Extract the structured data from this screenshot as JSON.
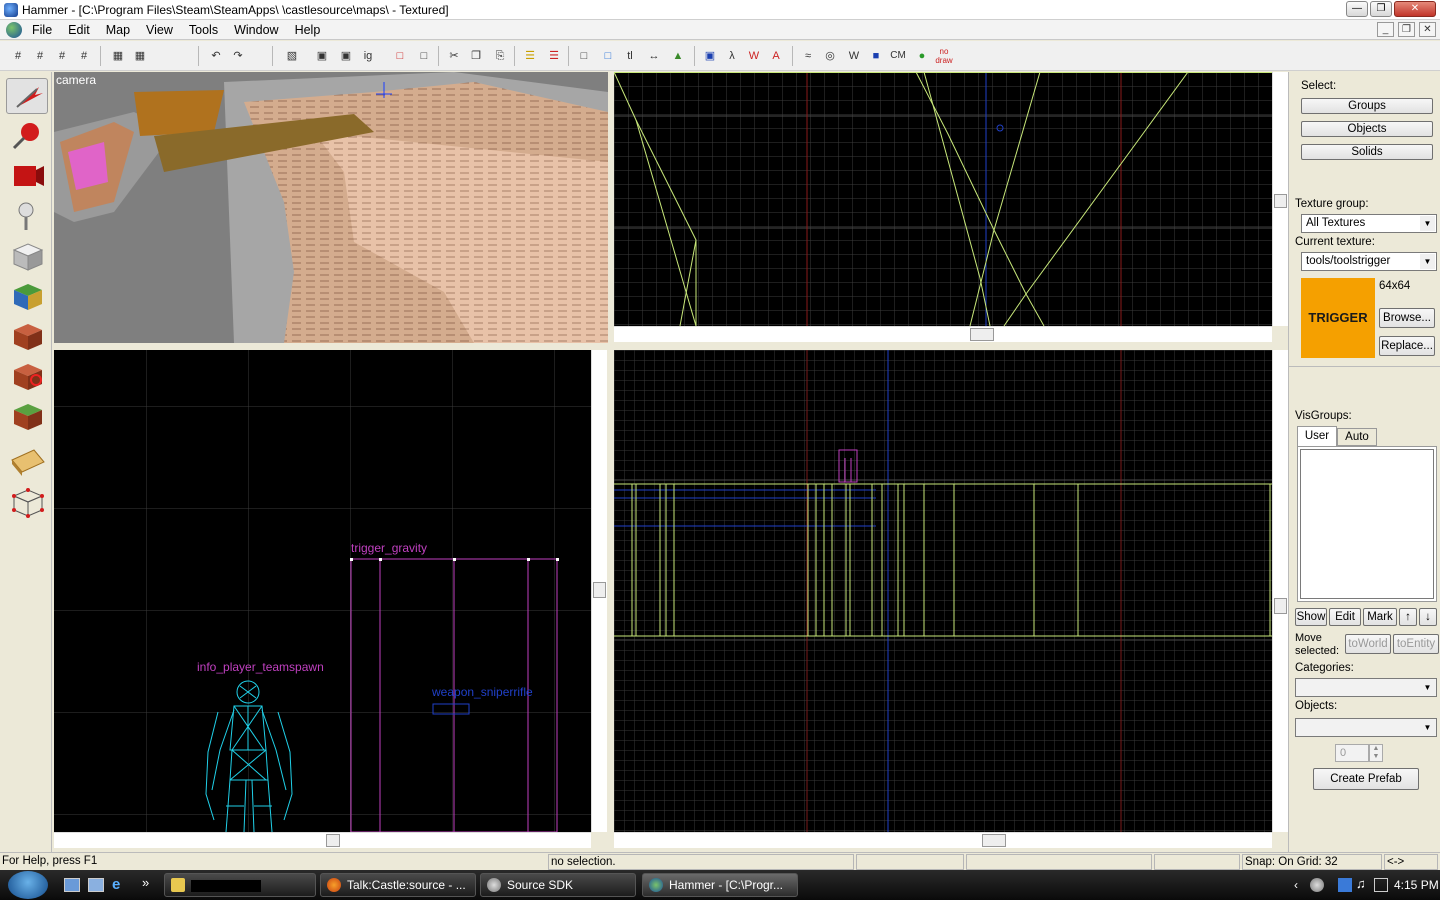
{
  "window": {
    "title": "Hammer - [C:\\Program Files\\Steam\\SteamApps\\                    \\castlesource\\maps\\                    - Textured]"
  },
  "menu": [
    "File",
    "Edit",
    "Map",
    "View",
    "Tools",
    "Window",
    "Help"
  ],
  "toolbar": {
    "icons": [
      "grid-icon",
      "grid-3d-icon",
      "grid-smaller-icon",
      "grid-larger-icon",
      "ig-icon",
      "cm-icon",
      "no-draw-icon"
    ],
    "ig_label": "ig",
    "tl_label": "tl",
    "cm_label": "CM",
    "nodraw_label": "no draw"
  },
  "viewports": {
    "camera_label": "camera",
    "entities": {
      "trigger": "trigger_gravity",
      "spawn": "info_player_teamspawn",
      "weapon": "weapon_sniperrifle"
    }
  },
  "right_panel": {
    "select_label": "Select:",
    "groups": "Groups",
    "objects": "Objects",
    "solids": "Solids",
    "texture_group_label": "Texture group:",
    "texture_group_value": "All Textures",
    "current_texture_label": "Current texture:",
    "current_texture_value": "tools/toolstrigger",
    "texture_preview_text": "TRIGGER",
    "texture_preview_color": "#f5a000",
    "texture_size": "64x64",
    "browse": "Browse...",
    "replace": "Replace...",
    "visgroups_label": "VisGroups:",
    "tab_user": "User",
    "tab_auto": "Auto",
    "show": "Show",
    "edit": "Edit",
    "mark": "Mark",
    "move_selected": "Move selected:",
    "to_world": "toWorld",
    "to_entity": "toEntity",
    "categories_label": "Categories:",
    "objects_label": "Objects:",
    "spin_value": "0",
    "create_prefab": "Create Prefab"
  },
  "status": {
    "help": "For Help, press F1",
    "selection": "no selection.",
    "snap": "Snap: On Grid: 32",
    "arrow": "<->"
  },
  "taskbar": {
    "items": [
      "Talk:Castle:source - ...",
      "Source SDK",
      "Hammer - [C:\\Progr..."
    ],
    "chevron": "»",
    "clock": "4:15 PM"
  }
}
